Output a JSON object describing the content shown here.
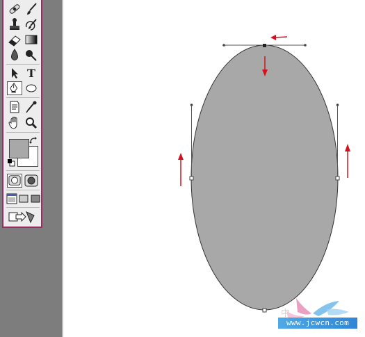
{
  "toolbox": {
    "tools": [
      {
        "name": "healing-brush-tool",
        "icon": "bandage-icon"
      },
      {
        "name": "brush-tool",
        "icon": "brush-icon"
      },
      {
        "name": "clone-stamp-tool",
        "icon": "stamp-icon"
      },
      {
        "name": "history-brush-tool",
        "icon": "history-brush-icon"
      },
      {
        "name": "eraser-tool",
        "icon": "eraser-icon"
      },
      {
        "name": "gradient-tool",
        "icon": "gradient-icon"
      },
      {
        "name": "blur-tool",
        "icon": "drop-icon"
      },
      {
        "name": "dodge-tool",
        "icon": "dodge-icon"
      },
      {
        "name": "path-selection-tool",
        "icon": "arrow-pointer-icon"
      },
      {
        "name": "type-tool",
        "icon": "type-icon",
        "label": "T"
      },
      {
        "name": "pen-tool",
        "icon": "pen-icon",
        "selected": true
      },
      {
        "name": "ellipse-tool",
        "icon": "ellipse-icon"
      },
      {
        "name": "notes-tool",
        "icon": "notes-icon"
      },
      {
        "name": "eyedropper-tool",
        "icon": "eyedropper-icon"
      },
      {
        "name": "hand-tool",
        "icon": "hand-icon"
      },
      {
        "name": "zoom-tool",
        "icon": "magnifier-icon"
      }
    ],
    "foreground_color": "#a8a8a8",
    "background_color": "#ffffff",
    "mask_modes": [
      "standard-mode-icon",
      "quick-mask-icon"
    ],
    "screen_modes": [
      "standard-screen-icon",
      "full-screen-menu-icon",
      "full-screen-icon"
    ],
    "jump_to": "jump-to-imageready-icon"
  },
  "colors": {
    "toolbox_border": "#9b2b63",
    "workspace": "#7d7d7d",
    "shape_fill": "#a8a8a8",
    "arrow": "#d2131e"
  },
  "watermark": {
    "text": "www.jcwcn.com"
  }
}
